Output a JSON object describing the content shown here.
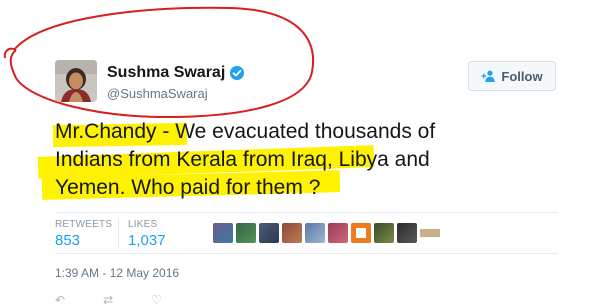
{
  "tweet": {
    "author_name": "Sushma Swaraj",
    "author_handle": "@SushmaSwaraj",
    "follow_label": "Follow",
    "text_lines": [
      "Mr.Chandy - We evacuated thousands of",
      "Indians from Kerala from Iraq, Libya and",
      "Yemen. Who paid for them ?"
    ],
    "retweets_label": "RETWEETS",
    "retweets_count": "853",
    "likes_label": "LIKES",
    "likes_count": "1,037",
    "timestamp": "1:39 AM - 12 May 2016"
  },
  "icons": {
    "verified": "verified-badge-icon",
    "follow": "add-user-icon",
    "reply": "reply-icon",
    "retweet": "retweet-icon",
    "like": "heart-icon"
  },
  "colors": {
    "highlight": "#fff200",
    "annotation": "#d81e1e",
    "link_blue": "#1da1f2"
  }
}
